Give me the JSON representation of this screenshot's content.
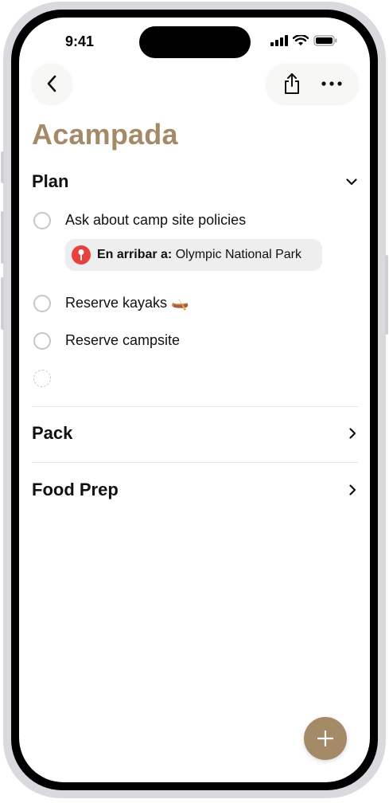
{
  "status_bar": {
    "time": "9:41"
  },
  "toolbar": {
    "back_icon": "chevron-left-icon",
    "share_icon": "share-icon",
    "more_icon": "ellipsis-icon"
  },
  "list": {
    "title": "Acampada",
    "accent_color": "#a48a67"
  },
  "sections": {
    "plan": {
      "title": "Plan",
      "expanded": true,
      "items": [
        {
          "text": "Ask about camp site policies",
          "completed": false
        },
        {
          "text": "Reserve kayaks",
          "emoji": "🛶",
          "completed": false
        },
        {
          "text": "Reserve campsite",
          "completed": false
        }
      ],
      "location_chip": {
        "prefix": "En arribar a:",
        "place": "Olympic National Park",
        "icon": "location-pin-icon",
        "color": "#e8403e"
      }
    },
    "pack": {
      "title": "Pack",
      "expanded": false
    },
    "food_prep": {
      "title": "Food Prep",
      "expanded": false
    }
  },
  "fab": {
    "icon": "plus-icon"
  }
}
